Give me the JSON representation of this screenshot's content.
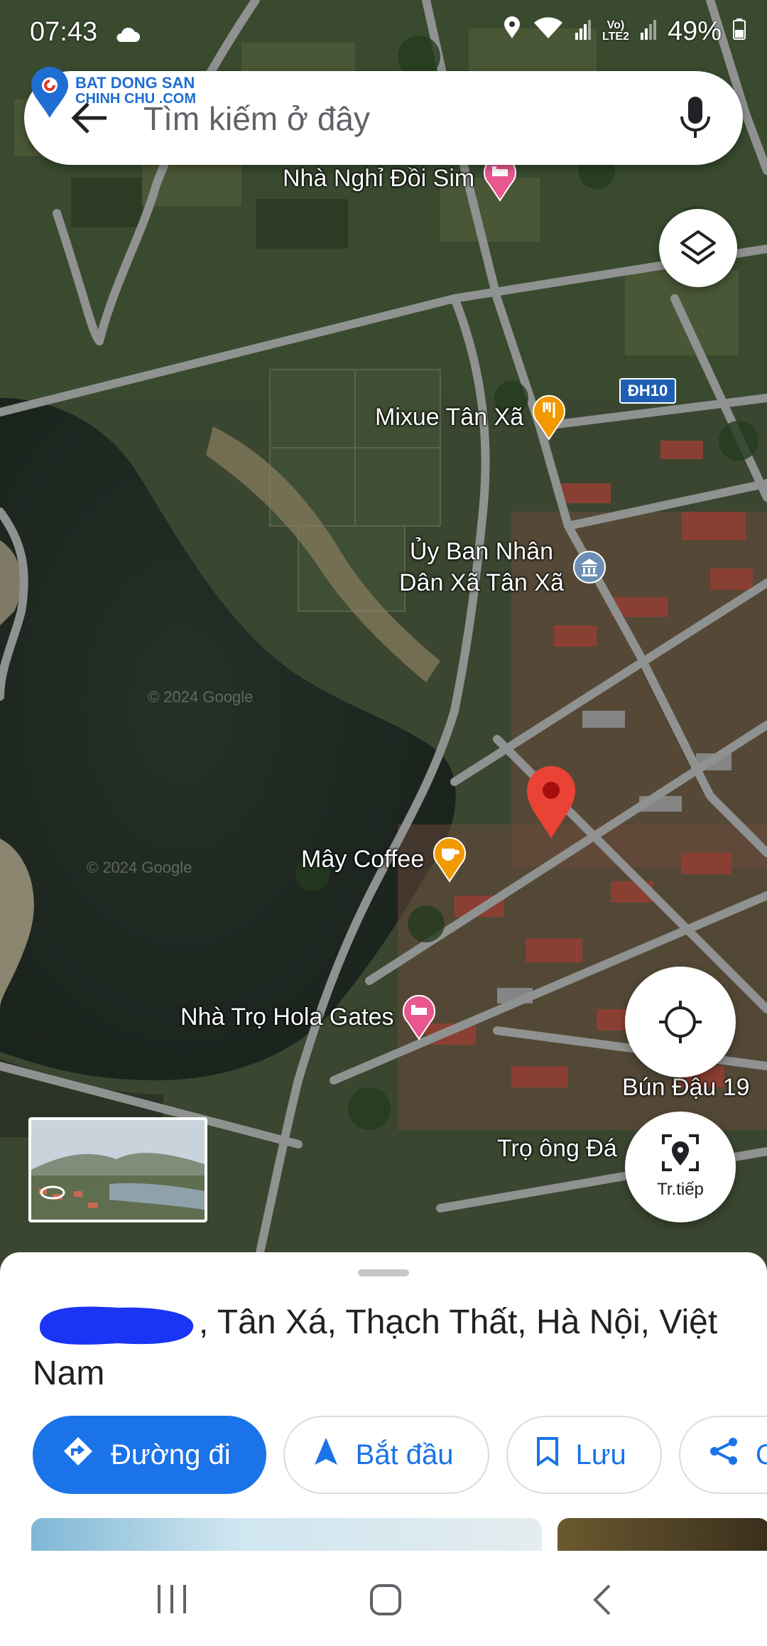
{
  "status_bar": {
    "time": "07:43",
    "volte": "Vo)\nLTE2",
    "battery": "49%",
    "icons": [
      "cloud-icon",
      "location-icon",
      "wifi-icon",
      "signal-icon",
      "battery-icon"
    ]
  },
  "logo": {
    "line1": "BAT DONG SAN",
    "line2": "CHINH CHU .COM"
  },
  "search": {
    "placeholder": "Tìm kiếm ở đây"
  },
  "map": {
    "road_shield": "ĐH10",
    "watermark": "© 2024 Google",
    "pois": [
      {
        "name": "Nhà Nghỉ Đồi Sim",
        "type": "hotel"
      },
      {
        "name": "Mixue Tân Xã",
        "type": "restaurant"
      },
      {
        "name": "Ủy Ban Nhân\nDân Xã Tân Xã",
        "type": "government"
      },
      {
        "name": "Mây Coffee",
        "type": "cafe"
      },
      {
        "name": "Nhà Trọ Hola Gates",
        "type": "hotel"
      },
      {
        "name": "Bún Đậu 19",
        "type": "label"
      },
      {
        "name": "Trọ ông Đá",
        "type": "label"
      }
    ]
  },
  "buttons": {
    "navigate_label": "Tr.tiếp"
  },
  "sheet": {
    "address": ", Tân Xá, Thạch Thất, Hà Nội, Việt Nam",
    "actions": [
      {
        "label": "Đường đi",
        "icon": "directions-icon"
      },
      {
        "label": "Bắt đầu",
        "icon": "navigation-arrow-icon"
      },
      {
        "label": "Lưu",
        "icon": "bookmark-icon"
      },
      {
        "label": "C",
        "icon": "share-icon"
      }
    ]
  },
  "colors": {
    "accent": "#1a73e8",
    "pin": "#ea4335",
    "poi_food": "#f29900",
    "poi_hotel": "#e8578f",
    "poi_gov": "#6b8fb5"
  }
}
